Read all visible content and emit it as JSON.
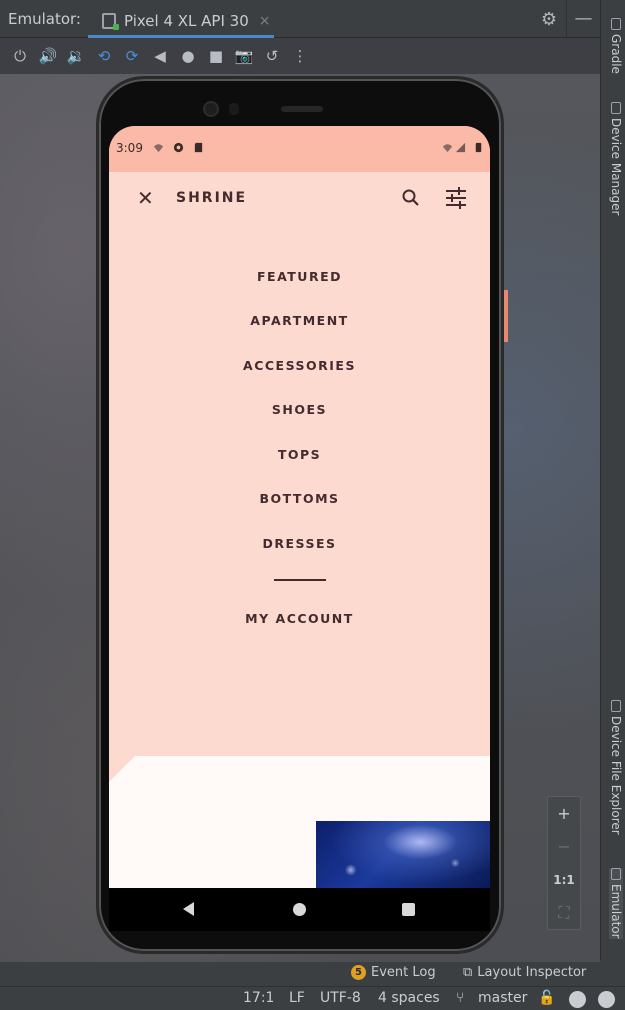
{
  "ide": {
    "panel_title": "Emulator:",
    "tab_label": "Pixel 4 XL API 30",
    "tab_close": "×",
    "sidebar_tabs": [
      "Gradle",
      "Device Manager",
      "Device File Explorer",
      "Emulator"
    ]
  },
  "toolbar": {
    "icons": [
      "power-icon",
      "volume-up-icon",
      "volume-down-icon",
      "rotate-left-icon",
      "rotate-right-icon",
      "back-icon",
      "home-icon",
      "overview-icon",
      "screenshot-icon",
      "snapshot-icon",
      "more-icon"
    ]
  },
  "phone": {
    "status_time": "3:09",
    "app_title": "SHRINE",
    "menu": [
      "FEATURED",
      "APARTMENT",
      "ACCESSORIES",
      "SHOES",
      "TOPS",
      "BOTTOMS",
      "DRESSES"
    ],
    "account": "MY ACCOUNT"
  },
  "zoom": {
    "plus": "+",
    "minus": "−",
    "one_to_one": "1:1"
  },
  "bottom": {
    "event_log_count": "5",
    "event_log": "Event Log",
    "layout_inspector": "Layout Inspector",
    "position": "17:1",
    "line_sep": "LF",
    "encoding": "UTF-8",
    "indent": "4 spaces",
    "branch": "master"
  },
  "colors": {
    "status_bar": "#fbb9a7",
    "backdrop": "#fcdad0",
    "text": "#442c2e",
    "front_layer": "#fff9f8",
    "accent": "#4a88c7"
  }
}
